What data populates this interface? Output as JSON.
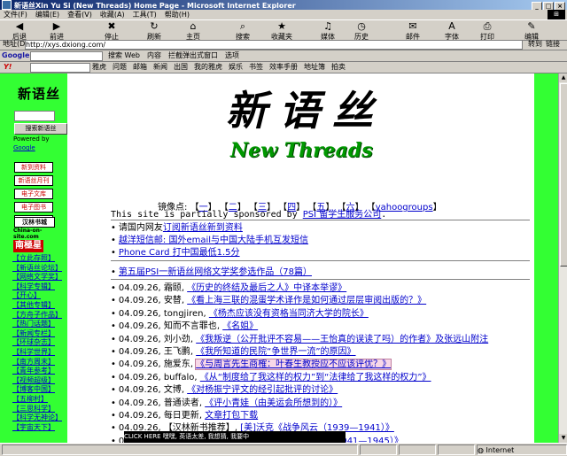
{
  "window": {
    "title": "新语丝Xin Yu Si (New Threads) Home Page - Microsoft Internet Explorer"
  },
  "menu": [
    "文件(F)",
    "编辑(E)",
    "查看(V)",
    "收藏(A)",
    "工具(T)",
    "帮助(H)"
  ],
  "toolbar": [
    {
      "label": "后退",
      "icon": "back-arrow-icon",
      "glyph": "◀"
    },
    {
      "label": "前进",
      "icon": "forward-arrow-icon",
      "glyph": "▶"
    },
    {
      "label": "停止",
      "icon": "stop-icon",
      "glyph": "✖"
    },
    {
      "label": "刷新",
      "icon": "refresh-icon",
      "glyph": "↻"
    },
    {
      "label": "主页",
      "icon": "home-icon",
      "glyph": "⌂"
    },
    {
      "label": "搜索",
      "icon": "search-icon",
      "glyph": "⌕"
    },
    {
      "label": "收藏夹",
      "icon": "favorites-icon",
      "glyph": "★"
    },
    {
      "label": "媒体",
      "icon": "media-icon",
      "glyph": "♫"
    },
    {
      "label": "历史",
      "icon": "history-icon",
      "glyph": "◷"
    },
    {
      "label": "邮件",
      "icon": "mail-icon",
      "glyph": "✉"
    },
    {
      "label": "字体",
      "icon": "font-icon",
      "glyph": "A"
    },
    {
      "label": "打印",
      "icon": "print-icon",
      "glyph": "⎙"
    },
    {
      "label": "编辑",
      "icon": "edit-icon",
      "glyph": "✎"
    }
  ],
  "address": {
    "label": "地址(D)",
    "url": "http://xys.dxiong.com/",
    "go": "转到",
    "links": "链接"
  },
  "google_bar": {
    "label": "Google -",
    "items": [
      "搜索 Web",
      "内容",
      "拦截弹出式窗口",
      "选项"
    ]
  },
  "yahoo_bar": {
    "label": "Y!",
    "search": "搜索",
    "items": [
      "雅虎",
      "问题",
      "邮箱",
      "新闻",
      "出国",
      "我的雅虎",
      "娱乐",
      "书签",
      "效率手册",
      "地址簿",
      "拍卖"
    ]
  },
  "sidebar": {
    "logo": "新语丝",
    "search_button": "搜索新语丝",
    "powered_by": "Powered by",
    "google": "Google",
    "nav": [
      "新到资料",
      "新语丝月刊",
      "电子文库",
      "电子图书",
      "新语丝家园"
    ],
    "banner": "汉林书城",
    "china_on_site": "China-on-site.com",
    "red_banner": "南極星",
    "links": [
      "【立此存照】",
      "【新语丝论坛】",
      "【网络文学奖】",
      "【科学专辑】",
      "【开心】",
      "【其他专辑】",
      "【方舟子作品】",
      "【热门话题】",
      "【新闻专栏】",
      "【环球杂志】",
      "【科学世界】",
      "【南方周末】",
      "【青年参考】",
      "【视频超级】",
      "【博客中国】",
      "【五柳村】",
      "【三思科学】",
      "【科学无神论】",
      "【宇宙天下】"
    ]
  },
  "brand": {
    "chinese": "新语丝",
    "english": "New Threads"
  },
  "mirrors": {
    "label": "镜像点:",
    "items": [
      "一",
      "二",
      "三",
      "四",
      "五",
      "六",
      "yahoogroups"
    ]
  },
  "sponsor": {
    "text": "This site is partially sponsored by ",
    "link": "PSI 留学生服务公司",
    "end": "."
  },
  "promo": [
    {
      "prefix": "请国内网友",
      "link": "订阅新语丝新到资料"
    },
    {
      "prefix": "",
      "link": "越洋短信邮: 国外email与中国大陆手机互发短信"
    },
    {
      "prefix": "",
      "link": "Phone Card 打中国最低1.5分"
    }
  ],
  "contest": {
    "link": "第五届PSI一新语丝网络文学奖参选作品（78篇）"
  },
  "news": [
    {
      "date": "04.09.26,",
      "author": "霜颐",
      "title": "《历史的终结及最后之人》中译本举谬》",
      "highlight": false
    },
    {
      "date": "04.09.26,",
      "author": "安替",
      "title": "《看上海三联的混蛋学术译作是如何通过层层审阅出版的？》",
      "highlight": false
    },
    {
      "date": "04.09.26,",
      "author": "tongjiren",
      "title": "《杨杰应该没有资格当同济大学的院长》",
      "highlight": false
    },
    {
      "date": "04.09.26,",
      "author": "知而不言罪也",
      "title": "《名姐》",
      "highlight": false
    },
    {
      "date": "04.09.26,",
      "author": "刘小劲",
      "title": "《我叛逆（公开批评不容易——王怡真的误读了吗）的作者》及张远山附注",
      "highlight": false
    },
    {
      "date": "04.09.26,",
      "author": "王飞鹏",
      "title": "《我所知道的民院“争世界一流”的原因》",
      "highlight": false
    },
    {
      "date": "04.09.26,",
      "author": "施爱东",
      "title": "《与周言先生商榷：叶春生教授应不应该评优？》",
      "highlight": true
    },
    {
      "date": "04.09.26,",
      "author": "buffalo",
      "title": "《从“制度给了我这样的权力”到“法律给了我这样的权力”》",
      "highlight": false
    },
    {
      "date": "04.09.26,",
      "author": "文博",
      "title": "《对杨振宁评文的经引起批评的讨论》",
      "highlight": false
    },
    {
      "date": "04.09.26,",
      "author": "普通读者",
      "title": "《评小青娃（由美运会所想到的）》",
      "highlight": false
    },
    {
      "date": "04.09.26,",
      "author": "每日更新",
      "title": "文章打包下载",
      "highlight": false
    },
    {
      "date": "04.09.26,",
      "author": "【汉林新书推荐】",
      "title": "[美]沃克《战争风云（1939—1941）》",
      "highlight": false
    },
    {
      "date": "04.09.26,",
      "author": "【汉林新书推荐】",
      "title": "[美]沃克《战争与回忆（1941—1945）》",
      "highlight": false
    }
  ],
  "bottom_ad": "CLICK HERE  嘿嘿,  英语太差, 我想猜, 我要中",
  "status": {
    "text": "",
    "zone": "Internet"
  },
  "colors": {
    "green": "#33ff33",
    "link": "#0000cc",
    "red": "#cc0000"
  }
}
